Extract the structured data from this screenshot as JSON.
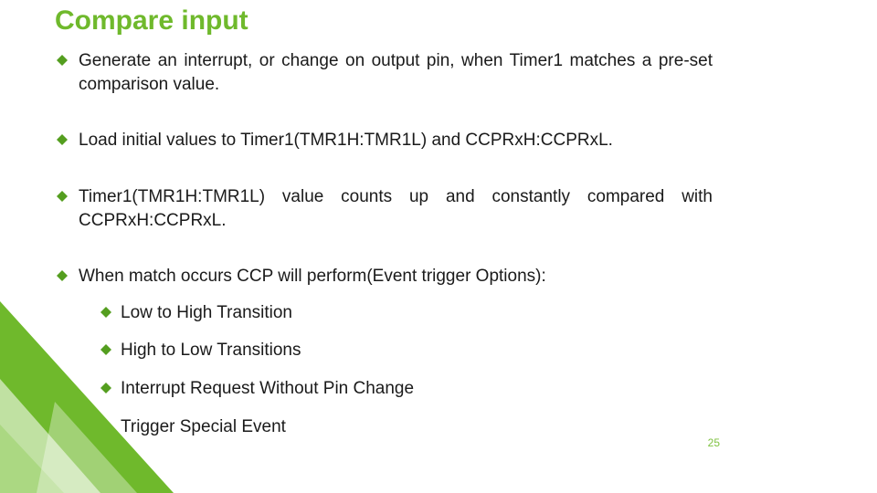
{
  "title": "Compare input",
  "bullets": [
    "Generate an interrupt, or change on output pin, when Timer1 matches a pre-set comparison value.",
    "Load initial values to Timer1(TMR1H:TMR1L) and CCPRxH:CCPRxL.",
    "Timer1(TMR1H:TMR1L) value counts up and constantly compared with CCPRxH:CCPRxL.",
    "When match occurs CCP will perform(Event trigger Options):"
  ],
  "sub_bullets": [
    "Low to High Transition",
    "High to Low Transitions",
    "Interrupt Request Without Pin Change",
    "Trigger Special Event"
  ],
  "page_number": "25",
  "colors": {
    "accent": "#6fb92c",
    "diamond": "#549e1f"
  }
}
